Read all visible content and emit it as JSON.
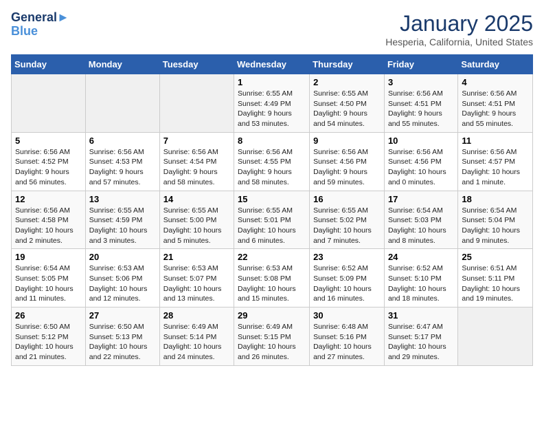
{
  "header": {
    "logo_line1": "General",
    "logo_line2": "Blue",
    "month_title": "January 2025",
    "location": "Hesperia, California, United States"
  },
  "days_of_week": [
    "Sunday",
    "Monday",
    "Tuesday",
    "Wednesday",
    "Thursday",
    "Friday",
    "Saturday"
  ],
  "weeks": [
    [
      {
        "day": "",
        "info": ""
      },
      {
        "day": "",
        "info": ""
      },
      {
        "day": "",
        "info": ""
      },
      {
        "day": "1",
        "info": "Sunrise: 6:55 AM\nSunset: 4:49 PM\nDaylight: 9 hours and 53 minutes."
      },
      {
        "day": "2",
        "info": "Sunrise: 6:55 AM\nSunset: 4:50 PM\nDaylight: 9 hours and 54 minutes."
      },
      {
        "day": "3",
        "info": "Sunrise: 6:56 AM\nSunset: 4:51 PM\nDaylight: 9 hours and 55 minutes."
      },
      {
        "day": "4",
        "info": "Sunrise: 6:56 AM\nSunset: 4:51 PM\nDaylight: 9 hours and 55 minutes."
      }
    ],
    [
      {
        "day": "5",
        "info": "Sunrise: 6:56 AM\nSunset: 4:52 PM\nDaylight: 9 hours and 56 minutes."
      },
      {
        "day": "6",
        "info": "Sunrise: 6:56 AM\nSunset: 4:53 PM\nDaylight: 9 hours and 57 minutes."
      },
      {
        "day": "7",
        "info": "Sunrise: 6:56 AM\nSunset: 4:54 PM\nDaylight: 9 hours and 58 minutes."
      },
      {
        "day": "8",
        "info": "Sunrise: 6:56 AM\nSunset: 4:55 PM\nDaylight: 9 hours and 58 minutes."
      },
      {
        "day": "9",
        "info": "Sunrise: 6:56 AM\nSunset: 4:56 PM\nDaylight: 9 hours and 59 minutes."
      },
      {
        "day": "10",
        "info": "Sunrise: 6:56 AM\nSunset: 4:56 PM\nDaylight: 10 hours and 0 minutes."
      },
      {
        "day": "11",
        "info": "Sunrise: 6:56 AM\nSunset: 4:57 PM\nDaylight: 10 hours and 1 minute."
      }
    ],
    [
      {
        "day": "12",
        "info": "Sunrise: 6:56 AM\nSunset: 4:58 PM\nDaylight: 10 hours and 2 minutes."
      },
      {
        "day": "13",
        "info": "Sunrise: 6:55 AM\nSunset: 4:59 PM\nDaylight: 10 hours and 3 minutes."
      },
      {
        "day": "14",
        "info": "Sunrise: 6:55 AM\nSunset: 5:00 PM\nDaylight: 10 hours and 5 minutes."
      },
      {
        "day": "15",
        "info": "Sunrise: 6:55 AM\nSunset: 5:01 PM\nDaylight: 10 hours and 6 minutes."
      },
      {
        "day": "16",
        "info": "Sunrise: 6:55 AM\nSunset: 5:02 PM\nDaylight: 10 hours and 7 minutes."
      },
      {
        "day": "17",
        "info": "Sunrise: 6:54 AM\nSunset: 5:03 PM\nDaylight: 10 hours and 8 minutes."
      },
      {
        "day": "18",
        "info": "Sunrise: 6:54 AM\nSunset: 5:04 PM\nDaylight: 10 hours and 9 minutes."
      }
    ],
    [
      {
        "day": "19",
        "info": "Sunrise: 6:54 AM\nSunset: 5:05 PM\nDaylight: 10 hours and 11 minutes."
      },
      {
        "day": "20",
        "info": "Sunrise: 6:53 AM\nSunset: 5:06 PM\nDaylight: 10 hours and 12 minutes."
      },
      {
        "day": "21",
        "info": "Sunrise: 6:53 AM\nSunset: 5:07 PM\nDaylight: 10 hours and 13 minutes."
      },
      {
        "day": "22",
        "info": "Sunrise: 6:53 AM\nSunset: 5:08 PM\nDaylight: 10 hours and 15 minutes."
      },
      {
        "day": "23",
        "info": "Sunrise: 6:52 AM\nSunset: 5:09 PM\nDaylight: 10 hours and 16 minutes."
      },
      {
        "day": "24",
        "info": "Sunrise: 6:52 AM\nSunset: 5:10 PM\nDaylight: 10 hours and 18 minutes."
      },
      {
        "day": "25",
        "info": "Sunrise: 6:51 AM\nSunset: 5:11 PM\nDaylight: 10 hours and 19 minutes."
      }
    ],
    [
      {
        "day": "26",
        "info": "Sunrise: 6:50 AM\nSunset: 5:12 PM\nDaylight: 10 hours and 21 minutes."
      },
      {
        "day": "27",
        "info": "Sunrise: 6:50 AM\nSunset: 5:13 PM\nDaylight: 10 hours and 22 minutes."
      },
      {
        "day": "28",
        "info": "Sunrise: 6:49 AM\nSunset: 5:14 PM\nDaylight: 10 hours and 24 minutes."
      },
      {
        "day": "29",
        "info": "Sunrise: 6:49 AM\nSunset: 5:15 PM\nDaylight: 10 hours and 26 minutes."
      },
      {
        "day": "30",
        "info": "Sunrise: 6:48 AM\nSunset: 5:16 PM\nDaylight: 10 hours and 27 minutes."
      },
      {
        "day": "31",
        "info": "Sunrise: 6:47 AM\nSunset: 5:17 PM\nDaylight: 10 hours and 29 minutes."
      },
      {
        "day": "",
        "info": ""
      }
    ]
  ]
}
